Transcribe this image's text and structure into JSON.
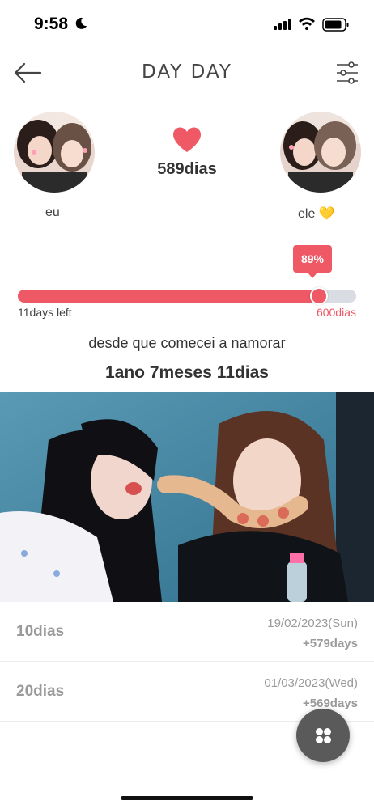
{
  "status_bar": {
    "time": "9:58"
  },
  "header": {
    "title": "DAY DAY"
  },
  "profiles": {
    "left": {
      "name": "eu"
    },
    "right": {
      "name": "ele 💛"
    }
  },
  "days_together": "589dias",
  "progress": {
    "percent_label": "89%",
    "fraction": 0.89,
    "left_label": "11days left",
    "right_label": "600dias"
  },
  "since_text": "desde que comecei a namorar",
  "duration": "1ano 7meses 11dias",
  "milestones": [
    {
      "label": "10dias",
      "date": "19/02/2023(Sun)",
      "diff": "+579days"
    },
    {
      "label": "20dias",
      "date": "01/03/2023(Wed)",
      "diff": "+569days"
    }
  ],
  "colors": {
    "accent": "#ef5865",
    "track": "#d9dce2",
    "fab": "#5a5a5a"
  }
}
